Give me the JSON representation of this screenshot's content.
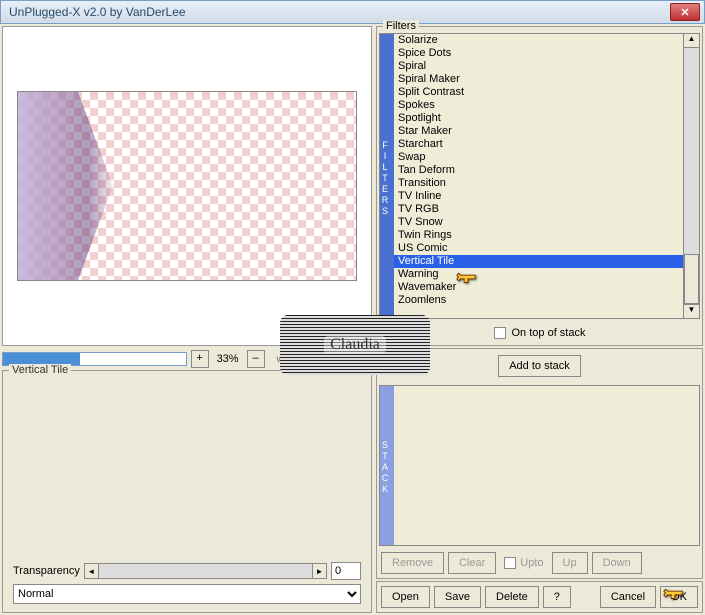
{
  "window": {
    "title": "UnPlugged-X v2.0 by VanDerLee"
  },
  "zoom": {
    "plus": "+",
    "minus": "–",
    "value": "33%",
    "watermark": "www.VanDerLee.com"
  },
  "progress_pct": 42,
  "settings_fieldset": {
    "label": "Vertical Tile"
  },
  "transparency": {
    "label": "Transparency",
    "value": "0"
  },
  "blend_mode": {
    "value": "Normal"
  },
  "filters": {
    "label": "Filters",
    "tab": "FILTERS",
    "items": [
      "Solarize",
      "Spice Dots",
      "Spiral",
      "Spiral Maker",
      "Split Contrast",
      "Spokes",
      "Spotlight",
      "Star Maker",
      "Starchart",
      "Swap",
      "Tan Deform",
      "Transition",
      "TV Inline",
      "TV RGB",
      "TV Snow",
      "Twin Rings",
      "US Comic",
      "Vertical Tile",
      "Warning",
      "Wavemaker",
      "Zoomlens"
    ],
    "selected": "Vertical Tile",
    "on_top": "On top of stack"
  },
  "stack": {
    "label": "Stack",
    "tab": "STACK",
    "add": "Add to stack",
    "remove": "Remove",
    "clear": "Clear",
    "upto": "Upto",
    "up": "Up",
    "down": "Down"
  },
  "buttons": {
    "open": "Open",
    "save": "Save",
    "delete": "Delete",
    "help": "?",
    "cancel": "Cancel",
    "ok": "OK"
  },
  "logo": "Claudia"
}
